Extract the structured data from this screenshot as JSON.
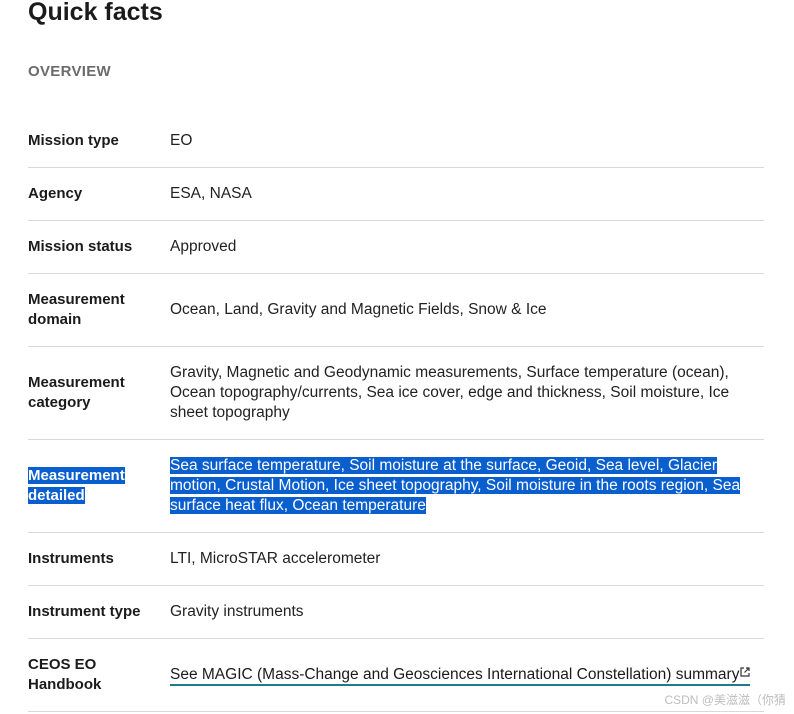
{
  "page_title": "Quick facts",
  "section_label": "OVERVIEW",
  "facts": [
    {
      "key": "Mission type",
      "value": "EO"
    },
    {
      "key": "Agency",
      "value": "ESA, NASA"
    },
    {
      "key": "Mission status",
      "value": "Approved"
    },
    {
      "key": "Measurement domain",
      "value": "Ocean, Land, Gravity and Magnetic Fields, Snow & Ice"
    },
    {
      "key": "Measurement category",
      "value": "Gravity, Magnetic and Geodynamic measurements, Surface temperature (ocean), Ocean topography/currents, Sea ice cover, edge and thickness, Soil moisture, Ice sheet topography"
    },
    {
      "key": "Measurement detailed",
      "value": "Sea surface temperature, Soil moisture at the surface, Geoid, Sea level, Glacier motion, Crustal Motion, Ice sheet topography, Soil moisture in the roots region, Sea surface heat flux, Ocean temperature"
    },
    {
      "key": "Instruments",
      "value": "LTI, MicroSTAR accelerometer"
    },
    {
      "key": "Instrument type",
      "value": "Gravity instruments"
    },
    {
      "key": "CEOS EO Handbook",
      "value": "See MAGIC (Mass-Change and Geosciences International Constellation) summary"
    }
  ],
  "selection_color": "#0a5fcf",
  "link_underline_color": "#1f7a8c",
  "link_icon": "external-link-icon",
  "watermark": "CSDN @美滋滋（你猜"
}
